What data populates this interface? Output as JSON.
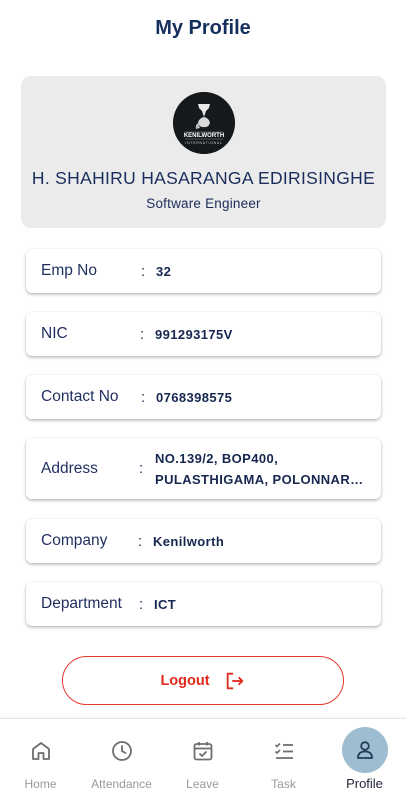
{
  "header": {
    "title": "My Profile"
  },
  "profile": {
    "logo_text": "KENILWORTH",
    "logo_subtext": "INTERNATIONAL",
    "name": "H. SHAHIRU HASARANGA EDIRISINGHE",
    "role": "Software Engineer"
  },
  "details": {
    "emp_no": {
      "label": "Emp No",
      "colon": ":",
      "value": "32"
    },
    "nic": {
      "label": "NIC",
      "colon": ":",
      "value": "991293175V"
    },
    "contact": {
      "label": "Contact No",
      "colon": ":",
      "value": "0768398575"
    },
    "address": {
      "label": "Address",
      "colon": ":",
      "line1": "NO.139/2, BOP400,",
      "line2": "PULASTHIGAMA, POLONNAR…"
    },
    "company": {
      "label": "Company",
      "colon": ":",
      "value": "Kenilworth"
    },
    "department": {
      "label": "Department",
      "colon": ":",
      "value": "ICT"
    }
  },
  "logout": {
    "label": "Logout",
    "icon": "logout-icon",
    "color": "#e12a1d"
  },
  "nav": {
    "items": [
      {
        "label": "Home",
        "icon": "home-icon"
      },
      {
        "label": "Attendance",
        "icon": "clock-icon"
      },
      {
        "label": "Leave",
        "icon": "calendar-check-icon"
      },
      {
        "label": "Task",
        "icon": "checklist-icon"
      },
      {
        "label": "Profile",
        "icon": "person-icon",
        "active": true
      }
    ]
  },
  "colors": {
    "primary_text": "#16305e",
    "card_bg": "#ebebeb",
    "active_nav_bg": "#9fbdd0",
    "danger": "#e23a2c"
  }
}
